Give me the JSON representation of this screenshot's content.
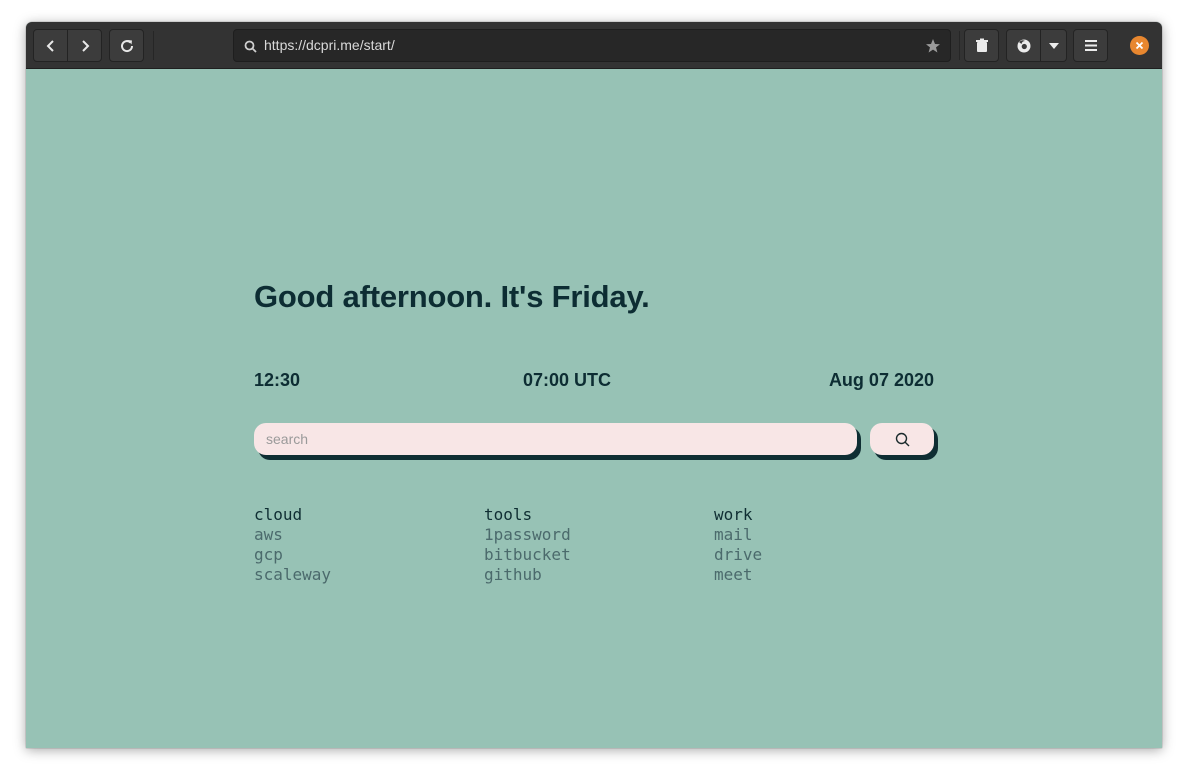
{
  "browser": {
    "url": "https://dcpri.me/start/"
  },
  "page": {
    "greeting": "Good afternoon. It's Friday.",
    "local_time": "12:30",
    "utc_time": "07:00 UTC",
    "date": "Aug 07 2020",
    "search": {
      "placeholder": "search"
    }
  },
  "links": [
    {
      "title": "cloud",
      "items": [
        "aws",
        "gcp",
        "scaleway"
      ]
    },
    {
      "title": "tools",
      "items": [
        "1password",
        "bitbucket",
        "github"
      ]
    },
    {
      "title": "work",
      "items": [
        "mail",
        "drive",
        "meet"
      ]
    }
  ],
  "colors": {
    "background": "#97c2b5",
    "text_dark": "#0d2d33",
    "search_fill": "#f8e6e6",
    "link_muted": "#4b6a6c",
    "close_button": "#e8872f"
  }
}
